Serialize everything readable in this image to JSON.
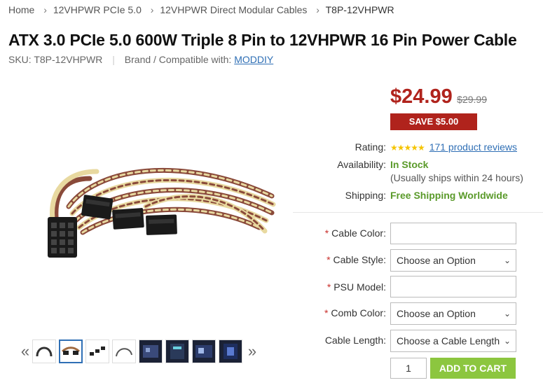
{
  "breadcrumb": {
    "items": [
      "Home",
      "12VHPWR PCIe 5.0",
      "12VHPWR Direct Modular Cables"
    ],
    "current": "T8P-12VHPWR",
    "separator": "›"
  },
  "product": {
    "title": "ATX 3.0 PCIe 5.0 600W Triple 8 Pin to 12VHPWR 16 Pin Power Cable",
    "sku_label": "SKU:",
    "sku": "T8P-12VHPWR",
    "brand_label": "Brand / Compatible with:",
    "brand": "MODDIY"
  },
  "price": {
    "current": "$24.99",
    "old": "$29.99",
    "save": "SAVE $5.00"
  },
  "info": {
    "rating_label": "Rating:",
    "stars": "★★★★★",
    "reviews": "171 product reviews",
    "availability_label": "Availability:",
    "availability": "In Stock",
    "ships_note": "(Usually ships within 24 hours)",
    "shipping_label": "Shipping:",
    "shipping": "Free Shipping Worldwide"
  },
  "options": {
    "required_mark": "*",
    "cable_color_label": "Cable Color:",
    "cable_color_value": "",
    "cable_style_label": "Cable Style:",
    "cable_style_value": "Choose an Option",
    "psu_model_label": "PSU Model:",
    "psu_model_value": "",
    "comb_color_label": "Comb Color:",
    "comb_color_value": "Choose an Option",
    "cable_length_label": "Cable Length:",
    "cable_length_value": "Choose a Cable Length"
  },
  "cart": {
    "quantity": "1",
    "button": "ADD TO CART"
  },
  "thumbs": {
    "prev": "«",
    "next": "»"
  },
  "colors": {
    "price_red": "#b0231c",
    "link_blue": "#2f6fb5",
    "stock_green": "#5a9a2a",
    "cart_green": "#8cc63f",
    "star_yellow": "#f5c400"
  }
}
